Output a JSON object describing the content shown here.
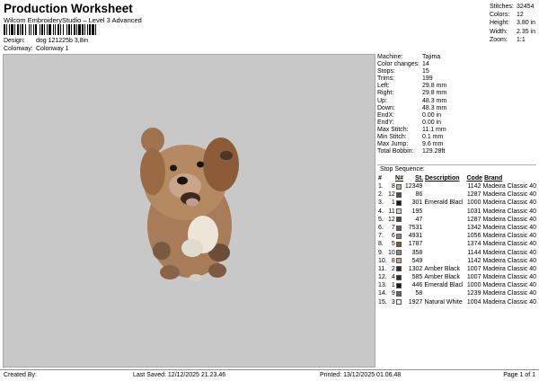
{
  "header": {
    "title": "Production Worksheet",
    "subtitle": "Wilcom EmbroideryStudio – Level 3 Advanced",
    "design_label": "Design:",
    "design_value": "dog 121225b 3,8in",
    "colorway_label": "Colonway:",
    "colorway_value": "Colonway 1"
  },
  "summary": [
    {
      "label": "Stitches:",
      "value": "32454"
    },
    {
      "label": "Colors:",
      "value": "12"
    },
    {
      "label": "Height:",
      "value": "3.80 in"
    },
    {
      "label": "Width:",
      "value": "2.35 in"
    },
    {
      "label": "Zoom:",
      "value": "1:1"
    }
  ],
  "details": [
    {
      "label": "Machine:",
      "value": "Tajima"
    },
    {
      "label": "Color changes:",
      "value": "14"
    },
    {
      "label": "Stops:",
      "value": "15"
    },
    {
      "label": "Trims:",
      "value": "199"
    },
    {
      "label": "Left:",
      "value": "29.8 mm"
    },
    {
      "label": "Right:",
      "value": "29.8 mm"
    },
    {
      "label": "Up:",
      "value": "48.3 mm"
    },
    {
      "label": "Down:",
      "value": "48.3 mm"
    },
    {
      "label": "EndX:",
      "value": "0.00 in"
    },
    {
      "label": "EndY:",
      "value": "0.00 in"
    },
    {
      "label": "Max Stitch:",
      "value": "11.1 mm"
    },
    {
      "label": "Min Stitch:",
      "value": "0.1 mm"
    },
    {
      "label": "Max Jump:",
      "value": "9.6 mm"
    },
    {
      "label": "Total Bobbin:",
      "value": "129.28ft"
    }
  ],
  "stop_sequence": {
    "title": "Stop Sequence:",
    "headers": [
      "#",
      "N#",
      "St.",
      "Description",
      "Code",
      "Brand"
    ],
    "rows": [
      {
        "idx": "1.",
        "n": "8",
        "color": "#c9a68a",
        "st": "12349",
        "desc": "",
        "code": "1142",
        "brand": "Madeira Classic 40"
      },
      {
        "idx": "2.",
        "n": "12",
        "color": "#5e4a3c",
        "st": "86",
        "desc": "",
        "code": "1287",
        "brand": "Madeira Classic 40"
      },
      {
        "idx": "3.",
        "n": "1",
        "color": "#1a1a1a",
        "st": "301",
        "desc": "Emerald Black",
        "code": "1000",
        "brand": "Madeira Classic 40"
      },
      {
        "idx": "4.",
        "n": "11",
        "color": "#d9c9c2",
        "st": "195",
        "desc": "",
        "code": "1031",
        "brand": "Madeira Classic 40"
      },
      {
        "idx": "5.",
        "n": "12",
        "color": "#5e4a3c",
        "st": "47",
        "desc": "",
        "code": "1287",
        "brand": "Madeira Classic 40"
      },
      {
        "idx": "6.",
        "n": "7",
        "color": "#6e5a4a",
        "st": "7531",
        "desc": "",
        "code": "1342",
        "brand": "Madeira Classic 40"
      },
      {
        "idx": "7.",
        "n": "6",
        "color": "#a57a55",
        "st": "4931",
        "desc": "",
        "code": "1056",
        "brand": "Madeira Classic 40"
      },
      {
        "idx": "8.",
        "n": "5",
        "color": "#8a5232",
        "st": "1787",
        "desc": "",
        "code": "1374",
        "brand": "Madeira Classic 40"
      },
      {
        "idx": "9.",
        "n": "10",
        "color": "#8d8a82",
        "st": "358",
        "desc": "",
        "code": "1144",
        "brand": "Madeira Classic 40"
      },
      {
        "idx": "10.",
        "n": "8",
        "color": "#c9a68a",
        "st": "549",
        "desc": "",
        "code": "1142",
        "brand": "Madeira Classic 40"
      },
      {
        "idx": "11.",
        "n": "2",
        "color": "#3a2a20",
        "st": "1302",
        "desc": "Amber Black",
        "code": "1007",
        "brand": "Madeira Classic 40"
      },
      {
        "idx": "12.",
        "n": "4",
        "color": "#3a2a20",
        "st": "585",
        "desc": "Amber Black",
        "code": "1007",
        "brand": "Madeira Classic 40"
      },
      {
        "idx": "13.",
        "n": "1",
        "color": "#1a1a1a",
        "st": "446",
        "desc": "Emerald Black",
        "code": "1000",
        "brand": "Madeira Classic 40"
      },
      {
        "idx": "14.",
        "n": "9",
        "color": "#6a6460",
        "st": "58",
        "desc": "",
        "code": "1239",
        "brand": "Madeira Classic 40"
      },
      {
        "idx": "15.",
        "n": "3",
        "color": "#f2f0ea",
        "st": "1927",
        "desc": "Natural White",
        "code": "1004",
        "brand": "Madeira Classic 40"
      }
    ]
  },
  "footer": {
    "created_by": "Created By:",
    "last_saved": "Last Saved: 12/12/2025 21.23.46",
    "printed": "Printed: 13/12/2025 01.06.48",
    "page": "Page 1 of 1"
  }
}
